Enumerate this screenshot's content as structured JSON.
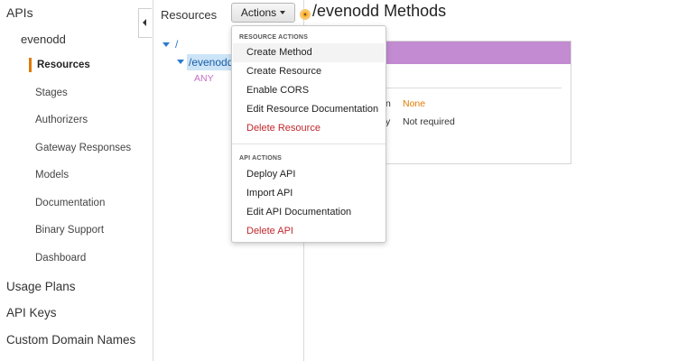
{
  "left_nav": {
    "apis_label": "APIs",
    "api_name": "evenodd",
    "sub_items": [
      "Resources",
      "Stages",
      "Authorizers",
      "Gateway Responses",
      "Models",
      "Documentation",
      "Binary Support",
      "Dashboard"
    ],
    "active_item": "Resources",
    "bottom_items": [
      "Usage Plans",
      "API Keys",
      "Custom Domain Names"
    ]
  },
  "resources": {
    "title": "Resources",
    "root_path": "/",
    "resource_path": "/evenodd",
    "method": "ANY"
  },
  "actions_button": {
    "label": "Actions"
  },
  "page_title": "/evenodd Methods",
  "method_card": {
    "row1_label": "n",
    "row1_value": "None",
    "row2_label": "y",
    "row2_value": "Not required"
  },
  "actions_menu": {
    "resource_section_label": "RESOURCE ACTIONS",
    "resource_items": [
      "Create Method",
      "Create Resource",
      "Enable CORS",
      "Edit Resource Documentation",
      "Delete Resource"
    ],
    "api_section_label": "API ACTIONS",
    "api_items": [
      "Deploy API",
      "Import API",
      "Edit API Documentation",
      "Delete API"
    ]
  },
  "colors": {
    "accent": "#e07b00",
    "link_blue": "#2a7bd0",
    "method_any": "#c470c4",
    "danger": "#c0282d",
    "card_header": "#c38bd1",
    "value_orange": "#e07b00"
  }
}
